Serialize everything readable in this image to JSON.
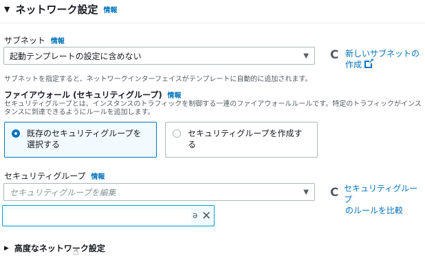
{
  "section": {
    "caret": "▼",
    "title": "ネットワーク設定",
    "info": "情報"
  },
  "subnet": {
    "label": "サブネット",
    "info": "情報",
    "value": "起動テンプレートの設定に含めない",
    "new_link_line1": "新しいサブネットの",
    "new_link_line2": "作成",
    "description": "サブネットを指定すると、ネットワークインターフェイスがテンプレートに自動的に追加されます。"
  },
  "firewall": {
    "label": "ファイアウォール (セキュリティグループ)",
    "info": "情報",
    "description_line1": "セキュリティグループとは、インスタンスのトラフィックを制御する一連のファイアウォールルールです。特定のトラフィックがインス",
    "description_line2": "タンスに到達できるようにルールを追加します。",
    "option_existing_line1": "既存のセキュリティグループを",
    "option_existing_line2": "選択する",
    "option_create_line1": "セキュリティグループを作成す",
    "option_create_line2": "る"
  },
  "security_group": {
    "label": "セキュリティグループ",
    "info": "情報",
    "placeholder": "セキュリティグループを編集",
    "compare_line1": "セキュリティグループ",
    "compare_line2": "のルールを比較",
    "token_close": "✕"
  },
  "advanced": {
    "caret": "▶",
    "label": "高度なネットワーク設定"
  },
  "icons": {
    "dropdown": "▼",
    "refresh": "C"
  },
  "colors": {
    "accent": "#0073bb",
    "text": "#16191f",
    "secondary_text": "#545b64",
    "border": "#aab7b8",
    "token_border": "#00a1c9"
  }
}
